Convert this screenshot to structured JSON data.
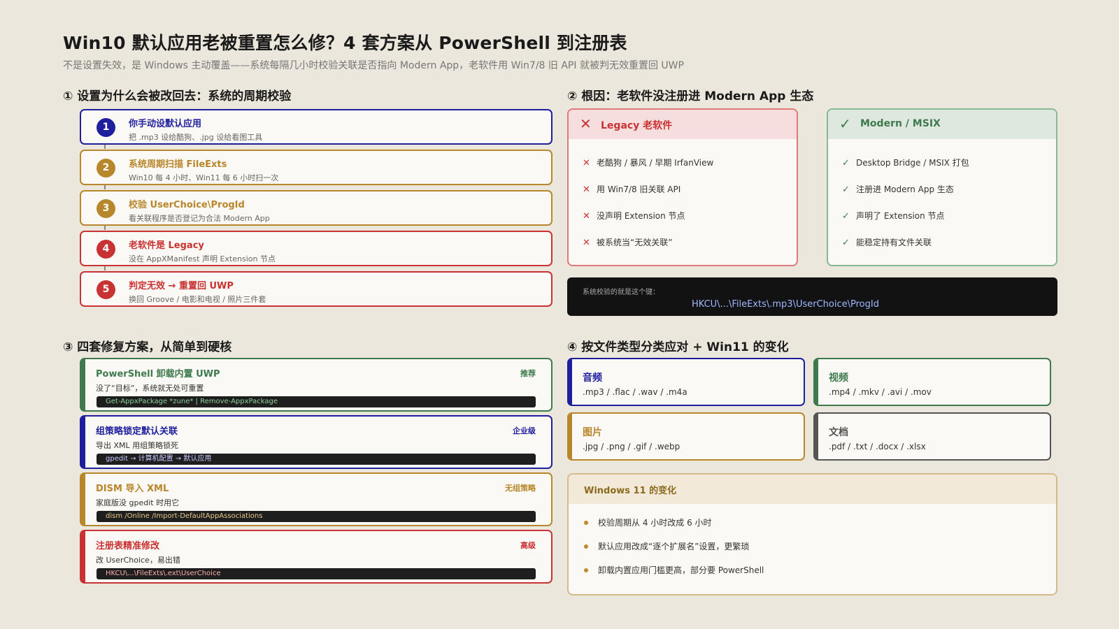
{
  "header": {
    "title": "Win10 默认应用老被重置怎么修？4 套方案从 PowerShell 到注册表",
    "subtitle": "不是设置失效，是 Windows 主动覆盖——系统每隔几小时校验关联是否指向 Modern App，老软件用 Win7/8 旧 API 就被判无效重置回 UWP"
  },
  "sections": {
    "s1": "① 设置为什么会被改回去：系统的周期校验",
    "s2": "② 根因：老软件没注册进 Modern App 生态",
    "s3": "③ 四套修复方案，从简单到硬核",
    "s4": "④ 按文件类型分类应对 + Win11 的变化"
  },
  "steps": [
    {
      "num": "1",
      "title": "你手动设默认应用",
      "desc": "把 .mp3 设给酷狗、.jpg 设给看图工具",
      "color": "#1f1f9e"
    },
    {
      "num": "2",
      "title": "系统周期扫描 FileExts",
      "desc": "Win10 每 4 小时、Win11 每 6 小时扫一次",
      "color": "#b8862b"
    },
    {
      "num": "3",
      "title": "校验 UserChoice\\ProgId",
      "desc": "看关联程序是否登记为合法 Modern App",
      "color": "#b8862b"
    },
    {
      "num": "4",
      "title": "老软件是 Legacy",
      "desc": "没在 AppXManifest 声明 Extension 节点",
      "color": "#c83232"
    },
    {
      "num": "5",
      "title": "判定无效 → 重置回 UWP",
      "desc": "换回 Groove / 电影和电视 / 照片三件套",
      "color": "#c83232"
    }
  ],
  "compare": {
    "legacy": {
      "icon": "✕",
      "label": "Legacy 老软件",
      "items": [
        "老酷狗 / 暴风 / 早期 IrfanView",
        "用 Win7/8 旧关联 API",
        "没声明 Extension 节点",
        "被系统当“无效关联”"
      ]
    },
    "modern": {
      "icon": "✓",
      "label": "Modern / MSIX",
      "items": [
        "Desktop Bridge / MSIX 打包",
        "注册进 Modern App 生态",
        "声明了 Extension 节点",
        "能稳定持有文件关联"
      ]
    },
    "key_label": "系统校验的就是这个键：",
    "key_path": "HKCU\\...\\FileExts\\.mp3\\UserChoice\\ProgId"
  },
  "fixes": [
    {
      "title": "PowerShell 卸载内置 UWP",
      "tag": "推荐",
      "desc": "没了“目标”，系统就无处可重置",
      "code": "Get-AppxPackage *zune* | Remove-AppxPackage",
      "color": "#3f7a4f",
      "code_color": "#8fd19e"
    },
    {
      "title": "组策略锁定默认关联",
      "tag": "企业级",
      "desc": "导出 XML 用组策略锁死",
      "code": "gpedit → 计算机配置 → 默认应用",
      "color": "#1f1f9e",
      "code_color": "#c9c9ff"
    },
    {
      "title": "DISM 导入 XML",
      "tag": "无组策略",
      "desc": "家庭版没 gpedit 时用它",
      "code": "dism /Online /Import-DefaultAppAssociations",
      "color": "#b8862b",
      "code_color": "#e8c98a"
    },
    {
      "title": "注册表精准修改",
      "tag": "高级",
      "desc": "改 UserChoice，易出错",
      "code": "HKCU\\...\\FileExts\\.ext\\UserChoice",
      "color": "#c83232",
      "code_color": "#ffb0b0"
    }
  ],
  "filetypes": [
    {
      "name": "音频",
      "ext": ".mp3 / .flac / .wav / .m4a",
      "color": "#1f1f9e"
    },
    {
      "name": "视频",
      "ext": ".mp4 / .mkv / .avi / .mov",
      "color": "#3f7a4f"
    },
    {
      "name": "图片",
      "ext": ".jpg / .png / .gif / .webp",
      "color": "#b8862b"
    },
    {
      "name": "文档",
      "ext": ".pdf / .txt / .docx / .xlsx",
      "color": "#555555"
    }
  ],
  "win11": {
    "title": "Windows 11 的变化",
    "items": [
      "校验周期从 4 小时改成 6 小时",
      "默认应用改成“逐个扩展名”设置，更繁琐",
      "卸载内置应用门槛更高，部分要 PowerShell"
    ]
  }
}
